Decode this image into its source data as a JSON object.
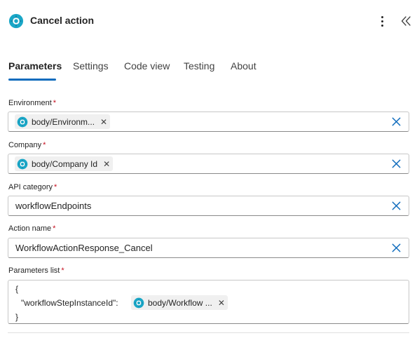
{
  "header": {
    "title": "Cancel action"
  },
  "tabs": [
    {
      "label": "Parameters"
    },
    {
      "label": "Settings"
    },
    {
      "label": "Code view"
    },
    {
      "label": "Testing"
    },
    {
      "label": "About"
    }
  ],
  "fields": {
    "environment": {
      "label": "Environment",
      "required": "*",
      "token": "body/Environm..."
    },
    "company": {
      "label": "Company",
      "required": "*",
      "token": "body/Company Id"
    },
    "api_category": {
      "label": "API category",
      "required": "*",
      "value": "workflowEndpoints"
    },
    "action_name": {
      "label": "Action name",
      "required": "*",
      "value": "WorkflowActionResponse_Cancel"
    },
    "parameters_list": {
      "label": "Parameters list",
      "required": "*",
      "open_brace": "{",
      "key": "\"workflowStepInstanceId\":",
      "token": "body/Workflow ...",
      "close_brace": "}"
    }
  },
  "token_remove_glyph": "✕",
  "colors": {
    "accent": "#0f6cbd",
    "required": "#c50f1f",
    "token_bg": "#f0f0f0",
    "icon_teal": "#1aa7c7"
  },
  "icons": {
    "app": "connector-icon",
    "more": "more-vertical-icon",
    "collapse": "double-chevron-left-icon",
    "clear": "dismiss-icon"
  }
}
